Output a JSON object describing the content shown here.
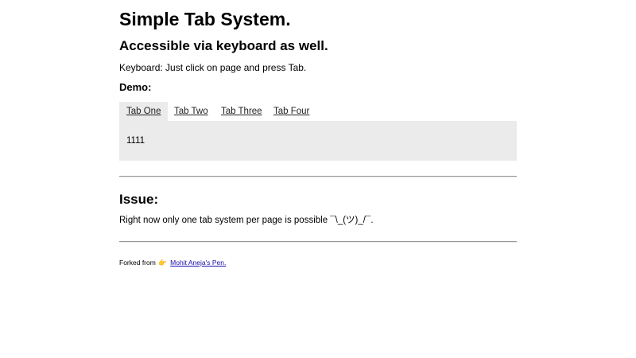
{
  "header": {
    "title": "Simple Tab System.",
    "subtitle": "Accessible via keyboard as well.",
    "keyboard_note": "Keyboard: Just click on page and press Tab.",
    "demo_label": "Demo:"
  },
  "tabs": {
    "items": [
      {
        "label": "Tab One",
        "active": true
      },
      {
        "label": "Tab Two",
        "active": false
      },
      {
        "label": "Tab Three",
        "active": false
      },
      {
        "label": "Tab Four",
        "active": false
      }
    ],
    "panel_content": "1111"
  },
  "issue": {
    "heading": "Issue:",
    "text": "Right now only one tab system per page is possible ¯\\_(ツ)_/¯."
  },
  "footer": {
    "prefix": "Forked from",
    "pointer_icon": "👉",
    "link_text": "Mohit Aneja's Pen."
  },
  "colors": {
    "active_tab_bg": "#ebebeb",
    "panel_bg": "#ebebeb",
    "link": "#1a0dab"
  }
}
